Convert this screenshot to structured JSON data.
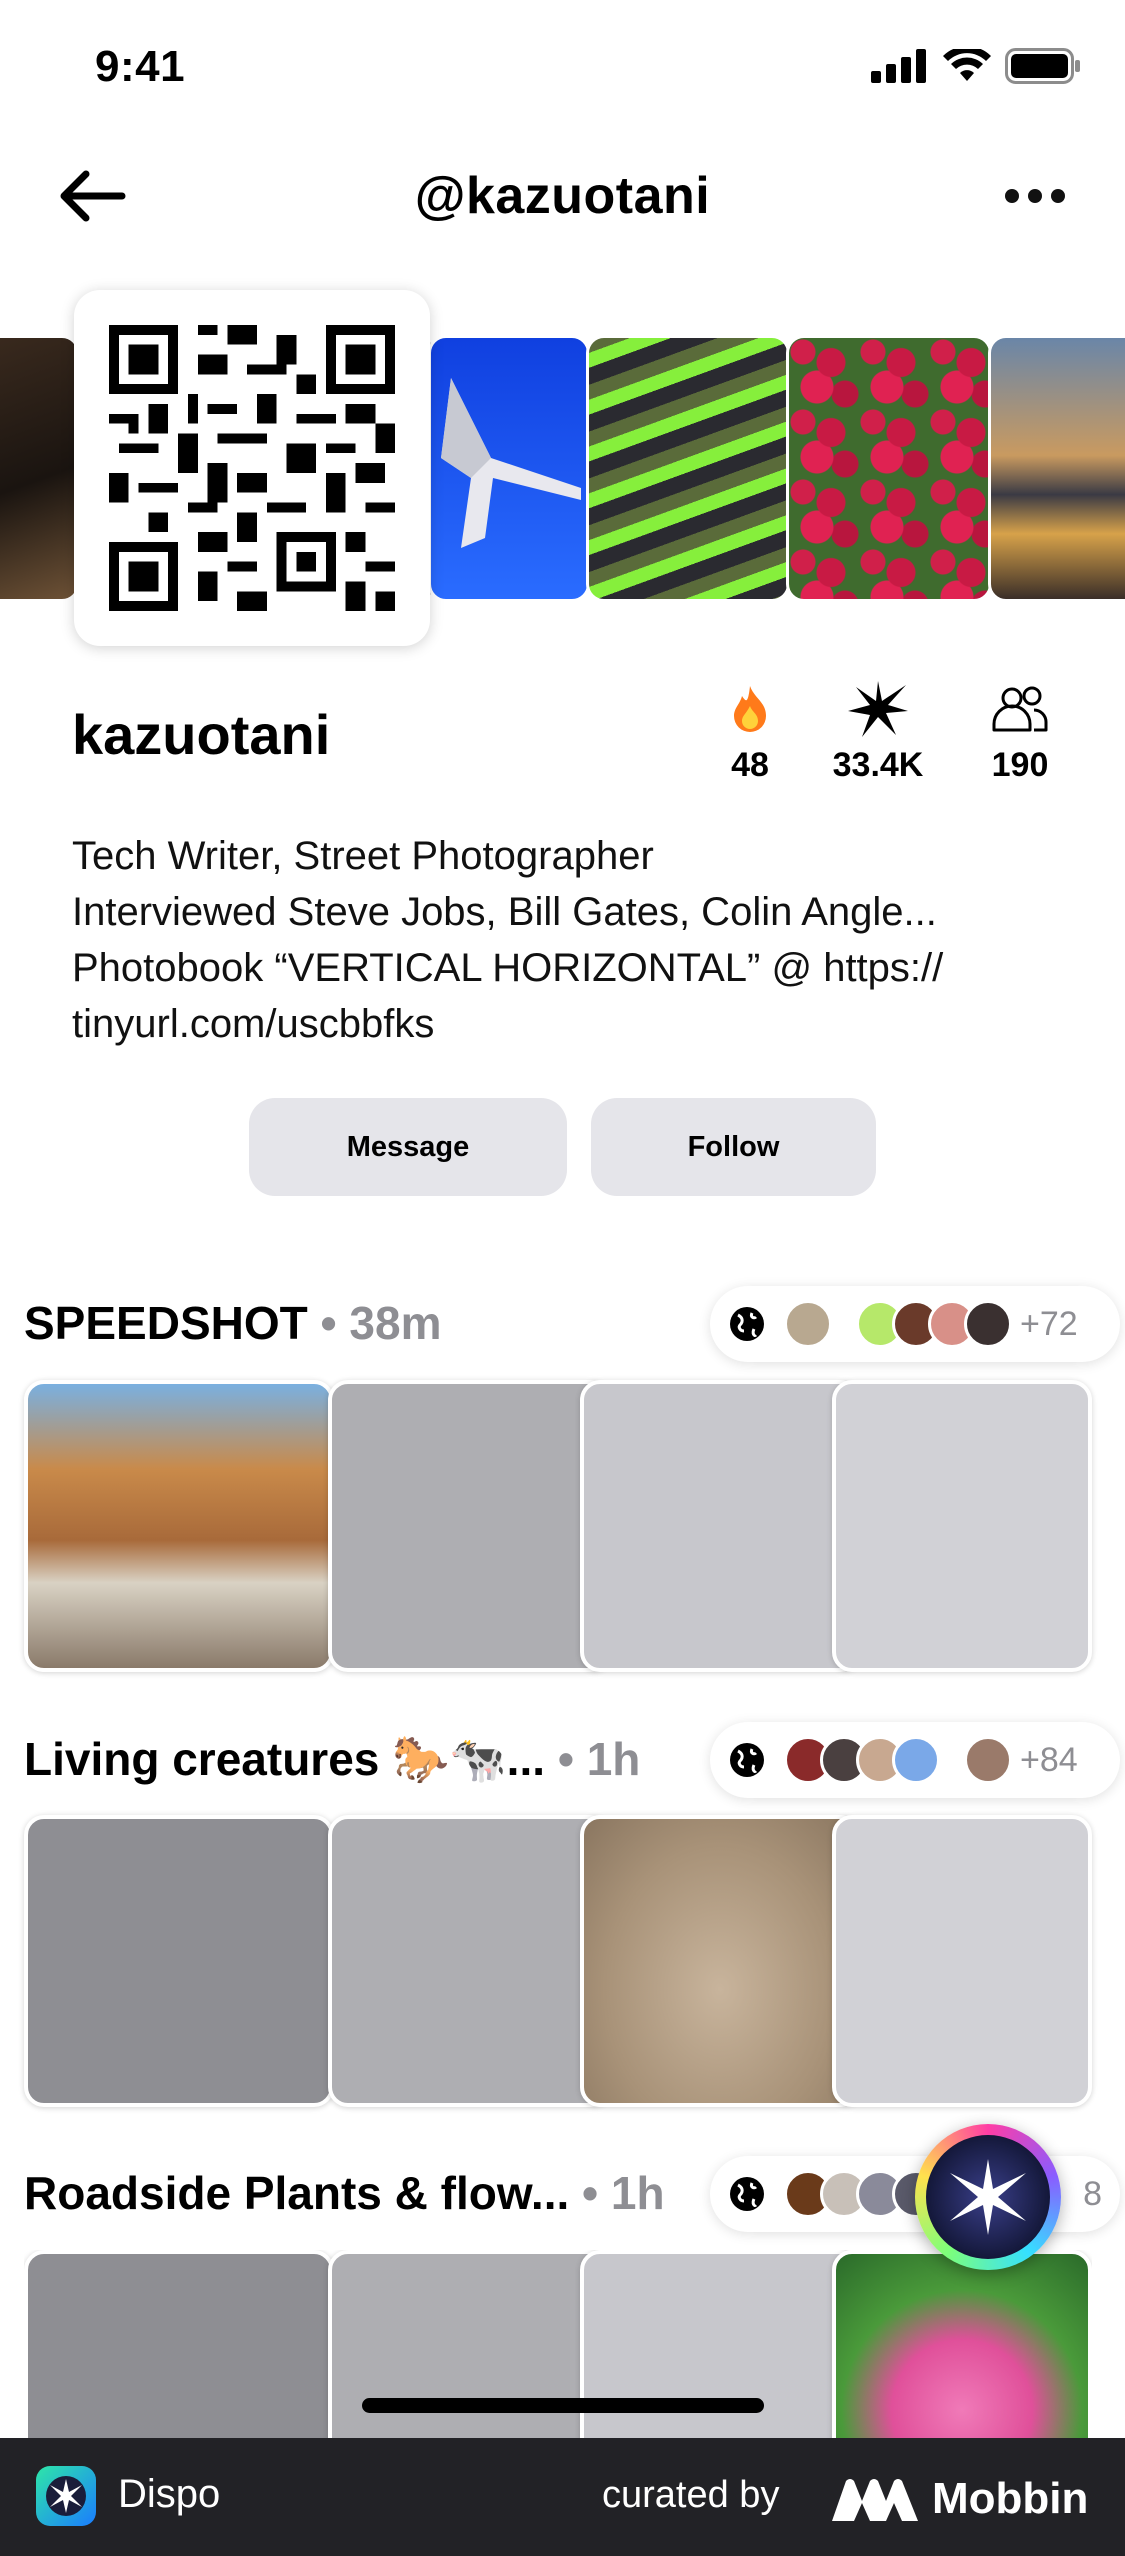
{
  "status_bar": {
    "time": "9:41",
    "icons": [
      "signal-icon",
      "wifi-icon",
      "battery-icon"
    ]
  },
  "nav": {
    "title": "@kazuotani",
    "back_icon": "back-arrow-icon",
    "more_icon": "more-icon"
  },
  "profile": {
    "name": "kazuotani",
    "stats": [
      {
        "icon": "fire-icon",
        "value": "48"
      },
      {
        "icon": "spark-icon",
        "value": "33.4K"
      },
      {
        "icon": "people-icon",
        "value": "190"
      }
    ],
    "bio_lines": [
      "Tech Writer, Street Photographer",
      "Interviewed Steve Jobs, Bill Gates, Colin Angle...",
      "Photobook “VERTICAL HORIZONTAL” @ https://",
      "tinyurl.com/uscbbfks"
    ]
  },
  "actions": {
    "message_label": "Message",
    "follow_label": "Follow"
  },
  "rolls": [
    {
      "title": "SPEEDSHOT",
      "time": "• 38m",
      "more_count": "+72"
    },
    {
      "title": "Living creatures 🐎🐄...",
      "time": "• 1h",
      "more_count": "+84"
    },
    {
      "title": "Roadside Plants & flow...",
      "time": "• 1h",
      "more_count": "8"
    }
  ],
  "banner": {
    "app_name": "Dispo",
    "curated_by": "curated by",
    "brand": "Mobbin"
  },
  "colors": {
    "button_bg": "#e5e5ea",
    "muted_text": "#8e8e93",
    "banner_bg": "#222226",
    "placeholder_dark": "#8e8e93",
    "placeholder_mid": "#aeaeb2",
    "placeholder_light": "#d1d1d6"
  }
}
